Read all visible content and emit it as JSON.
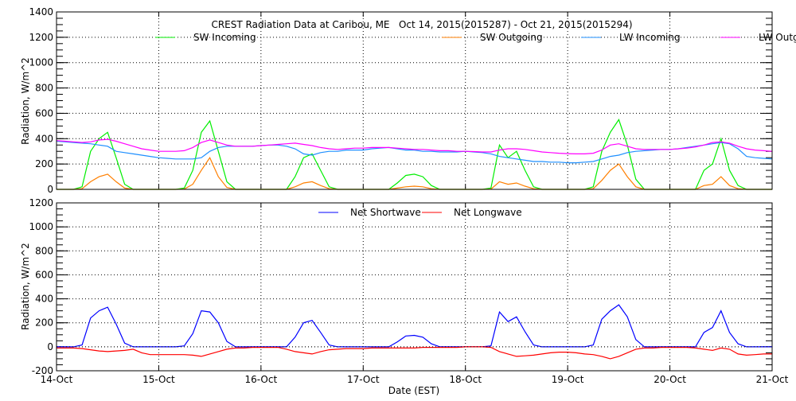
{
  "chart_data": [
    {
      "type": "line",
      "title": "CREST Radiation Data at Caribou, ME   Oct 14, 2015(2015287) - Oct 21, 2015(2015294)",
      "xlabel": "",
      "ylabel": "Radiation, W/m^2",
      "ylim": [
        0,
        1400
      ],
      "yticks": [
        "0",
        "200",
        "400",
        "600",
        "800",
        "1000",
        "1200",
        "1400"
      ],
      "x_unit": "hours since 14-Oct 00:00",
      "x_step_hours": 2,
      "legend_position": "top",
      "grid": true,
      "series": [
        {
          "name": "SW Incoming",
          "color": "#00ee00",
          "values": [
            0,
            0,
            0,
            20,
            300,
            400,
            450,
            250,
            40,
            0,
            0,
            0,
            0,
            0,
            0,
            10,
            150,
            450,
            540,
            300,
            60,
            0,
            0,
            0,
            0,
            0,
            0,
            0,
            100,
            250,
            280,
            150,
            20,
            0,
            0,
            0,
            0,
            0,
            0,
            0,
            50,
            110,
            120,
            100,
            30,
            0,
            0,
            0,
            0,
            0,
            0,
            10,
            350,
            250,
            300,
            150,
            20,
            0,
            0,
            0,
            0,
            0,
            0,
            20,
            300,
            450,
            550,
            350,
            80,
            0,
            0,
            0,
            0,
            0,
            0,
            0,
            150,
            200,
            400,
            150,
            30,
            0,
            0,
            0,
            0
          ]
        },
        {
          "name": "SW Outgoing",
          "color": "#ff7f00",
          "values": [
            0,
            0,
            0,
            5,
            60,
            100,
            120,
            60,
            10,
            0,
            0,
            0,
            0,
            0,
            0,
            2,
            40,
            150,
            250,
            100,
            15,
            0,
            0,
            0,
            0,
            0,
            0,
            0,
            20,
            50,
            60,
            30,
            5,
            0,
            0,
            0,
            0,
            0,
            0,
            0,
            10,
            20,
            25,
            20,
            5,
            0,
            0,
            0,
            0,
            0,
            0,
            2,
            60,
            40,
            50,
            25,
            5,
            0,
            0,
            0,
            0,
            0,
            0,
            5,
            70,
            150,
            200,
            100,
            20,
            0,
            0,
            0,
            0,
            0,
            0,
            0,
            30,
            40,
            100,
            30,
            5,
            0,
            0,
            0,
            0
          ]
        },
        {
          "name": "LW Incoming",
          "color": "#1e8fff",
          "values": [
            380,
            375,
            370,
            365,
            360,
            350,
            340,
            300,
            290,
            280,
            270,
            260,
            250,
            245,
            240,
            240,
            240,
            250,
            300,
            330,
            340,
            340,
            340,
            340,
            345,
            350,
            350,
            340,
            320,
            280,
            270,
            290,
            300,
            300,
            310,
            310,
            310,
            320,
            325,
            330,
            320,
            310,
            310,
            300,
            300,
            295,
            295,
            295,
            300,
            295,
            290,
            280,
            260,
            250,
            240,
            230,
            220,
            220,
            215,
            215,
            210,
            210,
            215,
            220,
            240,
            260,
            270,
            290,
            300,
            305,
            310,
            315,
            315,
            320,
            330,
            340,
            350,
            360,
            370,
            360,
            320,
            260,
            250,
            245,
            240
          ]
        },
        {
          "name": "LW Outgoing",
          "color": "#ff00ff",
          "values": [
            385,
            380,
            375,
            370,
            375,
            390,
            395,
            380,
            360,
            340,
            320,
            310,
            300,
            300,
            300,
            305,
            330,
            370,
            390,
            370,
            350,
            340,
            340,
            340,
            345,
            350,
            355,
            360,
            365,
            355,
            345,
            330,
            320,
            315,
            320,
            325,
            325,
            330,
            330,
            330,
            325,
            320,
            315,
            315,
            310,
            305,
            305,
            300,
            300,
            298,
            295,
            295,
            310,
            320,
            320,
            315,
            305,
            295,
            290,
            285,
            282,
            280,
            280,
            285,
            310,
            350,
            360,
            340,
            320,
            315,
            315,
            315,
            315,
            320,
            325,
            335,
            350,
            370,
            375,
            365,
            340,
            320,
            310,
            305,
            300
          ]
        }
      ]
    },
    {
      "type": "line",
      "xlabel": "Date (EST)",
      "ylabel": "Radiation, W/m^2",
      "ylim": [
        -200,
        1200
      ],
      "yticks": [
        "-200",
        "0",
        "200",
        "400",
        "600",
        "800",
        "1000",
        "1200"
      ],
      "xticks": [
        "14-Oct",
        "15-Oct",
        "16-Oct",
        "17-Oct",
        "18-Oct",
        "19-Oct",
        "20-Oct",
        "21-Oct"
      ],
      "x_unit": "hours since 14-Oct 00:00",
      "x_step_hours": 2,
      "legend_position": "top",
      "grid": true,
      "series": [
        {
          "name": "Net Shortwave",
          "color": "#0000ff",
          "values": [
            0,
            0,
            0,
            15,
            240,
            300,
            330,
            190,
            30,
            0,
            0,
            0,
            0,
            0,
            0,
            8,
            110,
            300,
            290,
            200,
            45,
            0,
            0,
            0,
            0,
            0,
            0,
            0,
            80,
            200,
            220,
            120,
            15,
            0,
            0,
            0,
            0,
            0,
            0,
            0,
            40,
            90,
            95,
            80,
            25,
            0,
            0,
            0,
            0,
            0,
            0,
            8,
            290,
            210,
            250,
            125,
            15,
            0,
            0,
            0,
            0,
            0,
            0,
            15,
            230,
            300,
            350,
            250,
            60,
            0,
            0,
            0,
            0,
            0,
            0,
            0,
            120,
            160,
            300,
            120,
            25,
            0,
            0,
            0,
            0
          ]
        },
        {
          "name": "Net Longwave",
          "color": "#ff0000",
          "values": [
            -10,
            -10,
            -10,
            -15,
            -25,
            -35,
            -40,
            -35,
            -30,
            -20,
            -50,
            -65,
            -65,
            -65,
            -65,
            -65,
            -70,
            -80,
            -60,
            -40,
            -20,
            -10,
            -10,
            -5,
            -5,
            -5,
            -5,
            -20,
            -40,
            -50,
            -60,
            -40,
            -25,
            -20,
            -15,
            -15,
            -15,
            -10,
            -10,
            -10,
            -10,
            -10,
            -10,
            -5,
            -5,
            -5,
            -5,
            -5,
            0,
            0,
            0,
            -5,
            -40,
            -60,
            -80,
            -75,
            -70,
            -60,
            -50,
            -45,
            -45,
            -50,
            -60,
            -65,
            -80,
            -100,
            -80,
            -50,
            -20,
            -10,
            -10,
            -5,
            -5,
            -5,
            -5,
            -10,
            -20,
            -30,
            -10,
            -20,
            -60,
            -70,
            -65,
            -60,
            -60
          ]
        }
      ]
    }
  ]
}
